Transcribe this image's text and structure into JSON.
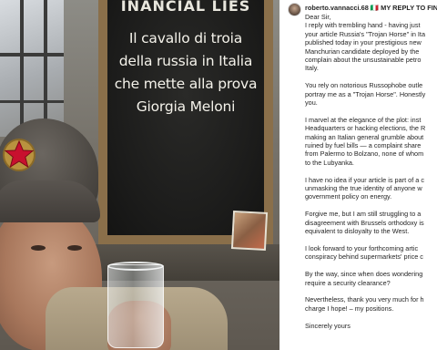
{
  "photo": {
    "board_header": "INANCIAL LIES",
    "board_lines": [
      "Il cavallo di troia",
      "della russia in Italia",
      "che mette alla prova",
      "Giorgia Meloni"
    ]
  },
  "post": {
    "username": "roberto.vannacci.68",
    "title_prefix": "MY REPLY TO FIN",
    "paragraphs": [
      [
        "Dear Sir,",
        "I reply with trembling hand - having just",
        "your article Russia's \"Trojan Horse\" in Ita",
        "published today in your prestigious new",
        "Manchurian candidate deployed by the",
        "complain about the unsustainable petro",
        "Italy."
      ],
      [
        "You rely on notorious Russophobe outle",
        "portray me as a \"Trojan Horse\". Honestly",
        "you."
      ],
      [
        "I marvel at the elegance of the plot: inst",
        "Headquarters or hacking elections, the R",
        "making an Italian general grumble about",
        "ruined by fuel bills — a complaint share",
        "from Palermo to Bolzano, none of whom",
        "to the Lubyanka."
      ],
      [
        "I have no idea if your article is part of a c",
        "unmasking the true identity of anyone w",
        "government policy on energy."
      ],
      [
        "Forgive me, but I am still struggling to a",
        "disagreement with Brussels orthodoxy is",
        "equivalent to disloyalty to the West."
      ],
      [
        "I look forward to your forthcoming artic",
        "conspiracy behind supermarkets' price c"
      ],
      [
        "By the way, since when does wondering",
        "require a security clearance?"
      ],
      [
        "Nevertheless, thank you very much for h",
        "charge I hope! – my positions."
      ],
      [
        "Sincerely yours"
      ]
    ]
  },
  "colors": {
    "board": "#1b1b1a",
    "frame": "#8a6f4a",
    "text": "#262626",
    "star": "#c8102e"
  }
}
